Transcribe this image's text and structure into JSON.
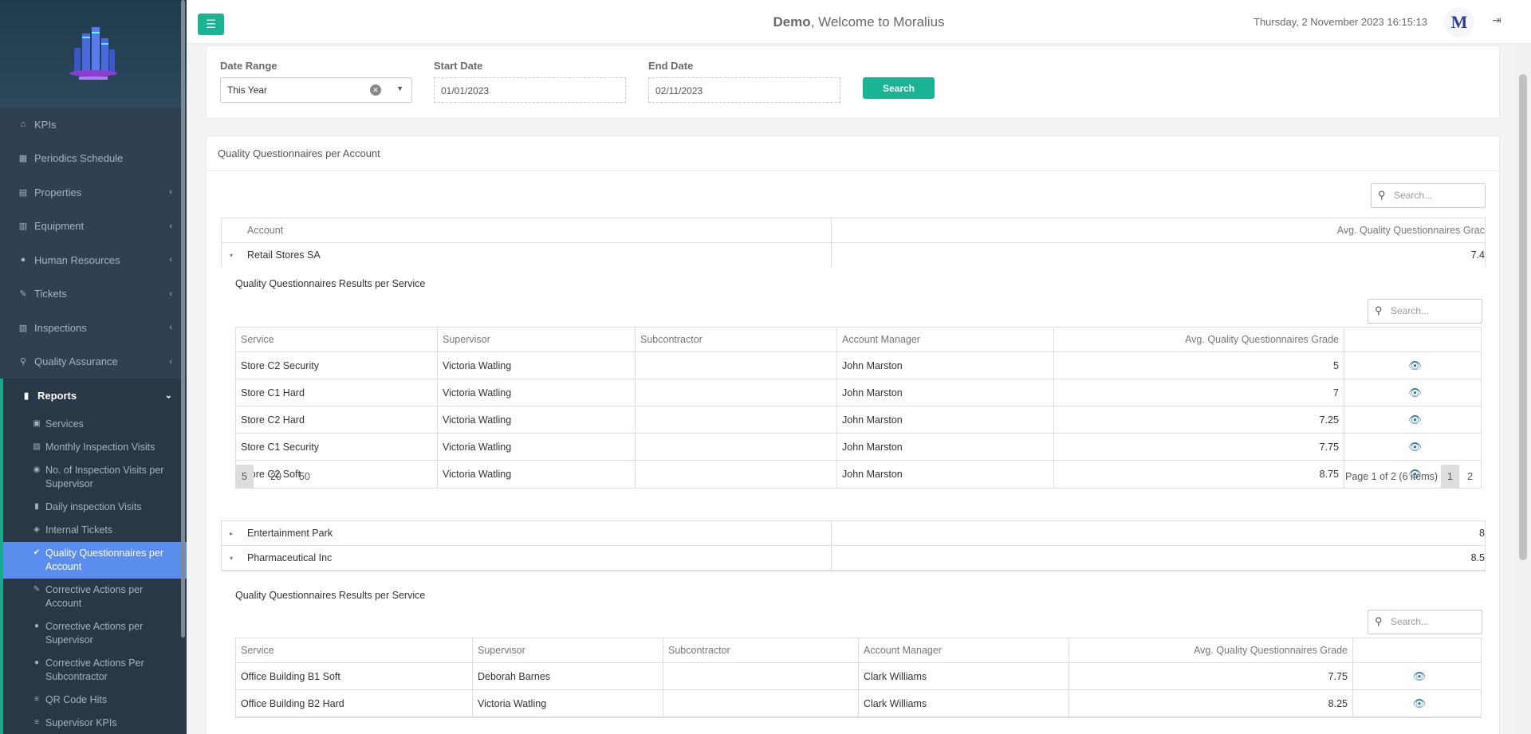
{
  "header": {
    "welcome_name": "Demo",
    "welcome_text": ", Welcome to Moralius",
    "datetime": "Thursday, 2 November 2023 16:15:13",
    "avatar_letter": "M"
  },
  "sidebar": {
    "items": [
      {
        "label": "KPIs",
        "icon": "home-icon"
      },
      {
        "label": "Periodics Schedule",
        "icon": "calendar-icon"
      },
      {
        "label": "Properties",
        "icon": "building-icon"
      },
      {
        "label": "Equipment",
        "icon": "equipment-icon"
      },
      {
        "label": "Human Resources",
        "icon": "users-icon"
      },
      {
        "label": "Tickets",
        "icon": "ticket-icon"
      },
      {
        "label": "Inspections",
        "icon": "map-icon"
      },
      {
        "label": "Quality Assurance",
        "icon": "search-icon"
      },
      {
        "label": "Reports",
        "icon": "book-icon"
      }
    ],
    "sub_items": [
      {
        "label": "Services"
      },
      {
        "label": "Monthly Inspection Visits"
      },
      {
        "label": "No. of Inspection Visits per Supervisor"
      },
      {
        "label": "Daily inspection Visits"
      },
      {
        "label": "Internal Tickets"
      },
      {
        "label": "Quality Questionnaires per Account"
      },
      {
        "label": "Corrective Actions per Account"
      },
      {
        "label": "Corrective Actions per Supervisor"
      },
      {
        "label": "Corrective Actions Per Subcontractor"
      },
      {
        "label": "QR Code Hits"
      },
      {
        "label": "Supervisor KPIs"
      }
    ]
  },
  "filters": {
    "date_range_label": "Date Range",
    "date_range_value": "This Year",
    "start_label": "Start Date",
    "start_value": "01/01/2023",
    "end_label": "End Date",
    "end_value": "02/11/2023",
    "search_label": "Search"
  },
  "panel": {
    "title": "Quality Questionnaires per Account",
    "search_placeholder": "Search...",
    "col_account": "Account",
    "col_grade": "Avg. Quality Questionnaires Grac",
    "accounts": [
      {
        "name": "Retail Stores SA",
        "grade": "7.4",
        "expanded": "▾"
      },
      {
        "name": "Entertainment Park",
        "grade": "8",
        "expanded": "▸"
      },
      {
        "name": "Pharmaceutical Inc",
        "grade": "8.5",
        "expanded": "▾"
      }
    ]
  },
  "detail1": {
    "title": "Quality Questionnaires Results per Service",
    "search_placeholder": "Search...",
    "headers": [
      "Service",
      "Supervisor",
      "Subcontractor",
      "Account Manager",
      "Avg. Quality Questionnaires Grade"
    ],
    "rows": [
      [
        "Store C2 Security",
        "Victoria Watling",
        "",
        "John Marston",
        "5"
      ],
      [
        "Store C1 Hard",
        "Victoria Watling",
        "",
        "John Marston",
        "7"
      ],
      [
        "Store C2 Hard",
        "Victoria Watling",
        "",
        "John Marston",
        "7.25"
      ],
      [
        "Store C1 Security",
        "Victoria Watling",
        "",
        "John Marston",
        "7.75"
      ],
      [
        "Store C2 Soft",
        "Victoria Watling",
        "",
        "John Marston",
        "8.75"
      ]
    ],
    "page_sizes": [
      "5",
      "20",
      "50"
    ],
    "page_info": "Page 1 of 2 (6 items)",
    "pages": [
      "1",
      "2"
    ]
  },
  "detail2": {
    "title": "Quality Questionnaires Results per Service",
    "search_placeholder": "Search...",
    "headers": [
      "Service",
      "Supervisor",
      "Subcontractor",
      "Account Manager",
      "Avg. Quality Questionnaires Grade"
    ],
    "rows": [
      [
        "Office Building B1 Soft",
        "Deborah Barnes",
        "",
        "Clark Williams",
        "7.75"
      ],
      [
        "Office Building B2 Hard",
        "Victoria Watling",
        "",
        "Clark Williams",
        "8.25"
      ]
    ]
  },
  "colors": {
    "sidebar": "#2f4050",
    "accent": "#1ab394",
    "active": "#5b8def"
  }
}
